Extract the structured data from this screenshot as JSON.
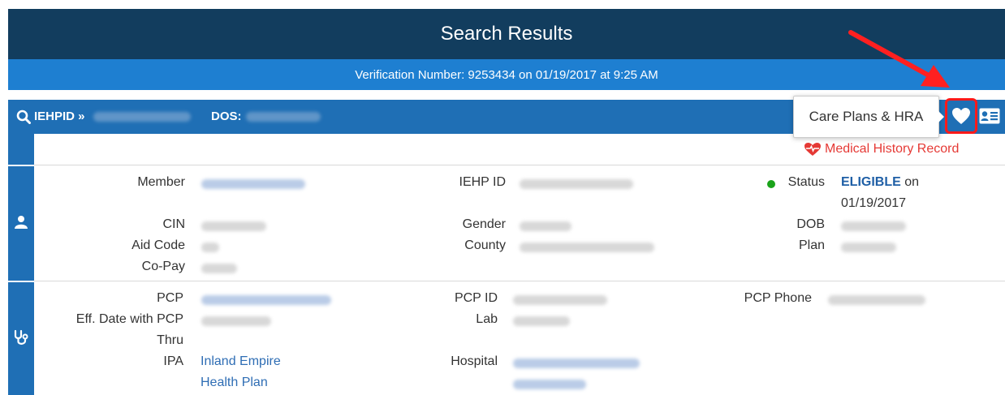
{
  "header": {
    "title": "Search Results",
    "verification": "Verification Number: 9253434 on 01/19/2017 at 9:25 AM"
  },
  "id_bar": {
    "iehpid_label": "IEHPID »",
    "dos_label": "DOS:"
  },
  "toolbar": {
    "tooltip": "Care Plans & HRA"
  },
  "medical_history_link": "Medical History Record",
  "member_section": {
    "member_label": "Member",
    "iehp_id_label": "IEHP ID",
    "status_label": "Status",
    "status_value": "ELIGIBLE",
    "status_on": "on",
    "status_date": "01/19/2017",
    "cin_label": "CIN",
    "gender_label": "Gender",
    "dob_label": "DOB",
    "aid_code_label": "Aid Code",
    "county_label": "County",
    "plan_label": "Plan",
    "copay_label": "Co-Pay"
  },
  "pcp_section": {
    "pcp_label": "PCP",
    "pcp_id_label": "PCP ID",
    "pcp_phone_label": "PCP Phone",
    "eff_date_label": "Eff. Date with PCP",
    "lab_label": "Lab",
    "thru_label": "Thru",
    "ipa_label": "IPA",
    "ipa_value_line1": "Inland Empire",
    "ipa_value_line2": "Health Plan",
    "hospital_label": "Hospital"
  },
  "colors": {
    "title_bg": "#123d5e",
    "verification_bg": "#1e7fd1",
    "id_bar_bg": "#1f6fb5",
    "highlight": "#ff1a1a",
    "status_dot": "#1aa31a",
    "medical_history": "#e53935"
  },
  "icons": [
    "search-icon",
    "heart-icon",
    "member-card-icon",
    "heartbeat-icon",
    "person-icon",
    "stethoscope-icon"
  ]
}
